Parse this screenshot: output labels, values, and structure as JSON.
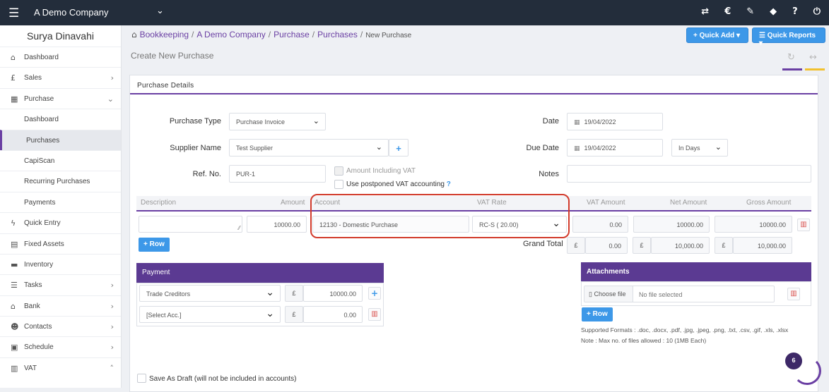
{
  "topbar": {
    "company": "A Demo Company"
  },
  "sidebar": {
    "user": "Surya Dinavahi",
    "items": [
      {
        "label": "Dashboard",
        "icon": "home-icon"
      },
      {
        "label": "Sales",
        "icon": "pound-icon"
      },
      {
        "label": "Purchase",
        "icon": "barcode-icon"
      },
      {
        "label": "Dashboard"
      },
      {
        "label": "Purchases"
      },
      {
        "label": "CapiScan"
      },
      {
        "label": "Recurring Purchases"
      },
      {
        "label": "Payments"
      },
      {
        "label": "Quick Entry",
        "icon": "bolt-icon"
      },
      {
        "label": "Fixed Assets",
        "icon": "building-icon"
      },
      {
        "label": "Inventory",
        "icon": "truck-icon"
      },
      {
        "label": "Tasks",
        "icon": "tasks-icon"
      },
      {
        "label": "Bank",
        "icon": "bank-icon"
      },
      {
        "label": "Contacts",
        "icon": "users-icon"
      },
      {
        "label": "Schedule",
        "icon": "calendar-icon"
      },
      {
        "label": "VAT",
        "icon": "vat-icon"
      }
    ]
  },
  "breadcrumb": {
    "b1": "Bookkeeping",
    "b2": "A Demo Company",
    "b3": "Purchase",
    "b4": "Purchases",
    "current": "New Purchase"
  },
  "header": {
    "quick_add": "Quick Add",
    "quick_reports": "Quick Reports"
  },
  "page": {
    "title": "Create New Purchase",
    "section": "Purchase Details"
  },
  "form": {
    "purchase_type_label": "Purchase Type",
    "purchase_type": "Purchase Invoice",
    "supplier_label": "Supplier Name",
    "supplier": "Test Supplier",
    "ref_label": "Ref. No.",
    "ref": "PUR-1",
    "amount_incl_vat": "Amount Including VAT",
    "postponed_vat": "Use postponed VAT accounting",
    "postponed_help": "?",
    "date_label": "Date",
    "date": "19/04/2022",
    "due_label": "Due Date",
    "due_date": "19/04/2022",
    "due_unit": "In Days",
    "notes_label": "Notes"
  },
  "table": {
    "headers": {
      "description": "Description",
      "amount": "Amount",
      "account": "Account",
      "vat_rate": "VAT Rate",
      "vat_amount": "VAT Amount",
      "net_amount": "Net Amount",
      "gross_amount": "Gross Amount"
    },
    "row": {
      "description": "",
      "amount": "10000.00",
      "account": "12130 - Domestic Purchase",
      "vat_rate": "RC-S ( 20.00)",
      "vat_amount": "0.00",
      "net_amount": "10000.00",
      "gross_amount": "10000.00"
    },
    "add_row": "+ Row",
    "grand_total_label": "Grand Total",
    "currency": "£",
    "total_vat": "0.00",
    "total_net": "10,000.00",
    "total_gross": "10,000.00"
  },
  "payment": {
    "title": "Payment",
    "rows": [
      {
        "account": "Trade Creditors",
        "currency": "£",
        "amount": "10000.00"
      },
      {
        "account": "[Select Acc.]",
        "currency": "£",
        "amount": "0.00"
      }
    ]
  },
  "attachments": {
    "title": "Attachments",
    "choose": "Choose file",
    "no_file": "No file selected",
    "add_row": "+ Row",
    "formats": "Supported Formats : .doc, .docx, .pdf, .jpg, .jpeg, .png, .txt, .csv, .gif, .xls, .xlsx",
    "note": "Note : Max no. of files allowed : 10 (1MB Each)"
  },
  "draft": {
    "label": "Save As Draft (will not be included in accounts)"
  },
  "badge": {
    "count": "6"
  },
  "colors": {
    "accent": "#6a3fa3",
    "blue": "#3d98e8",
    "highlight": "#d23b2c",
    "topbar": "#232d3b"
  }
}
